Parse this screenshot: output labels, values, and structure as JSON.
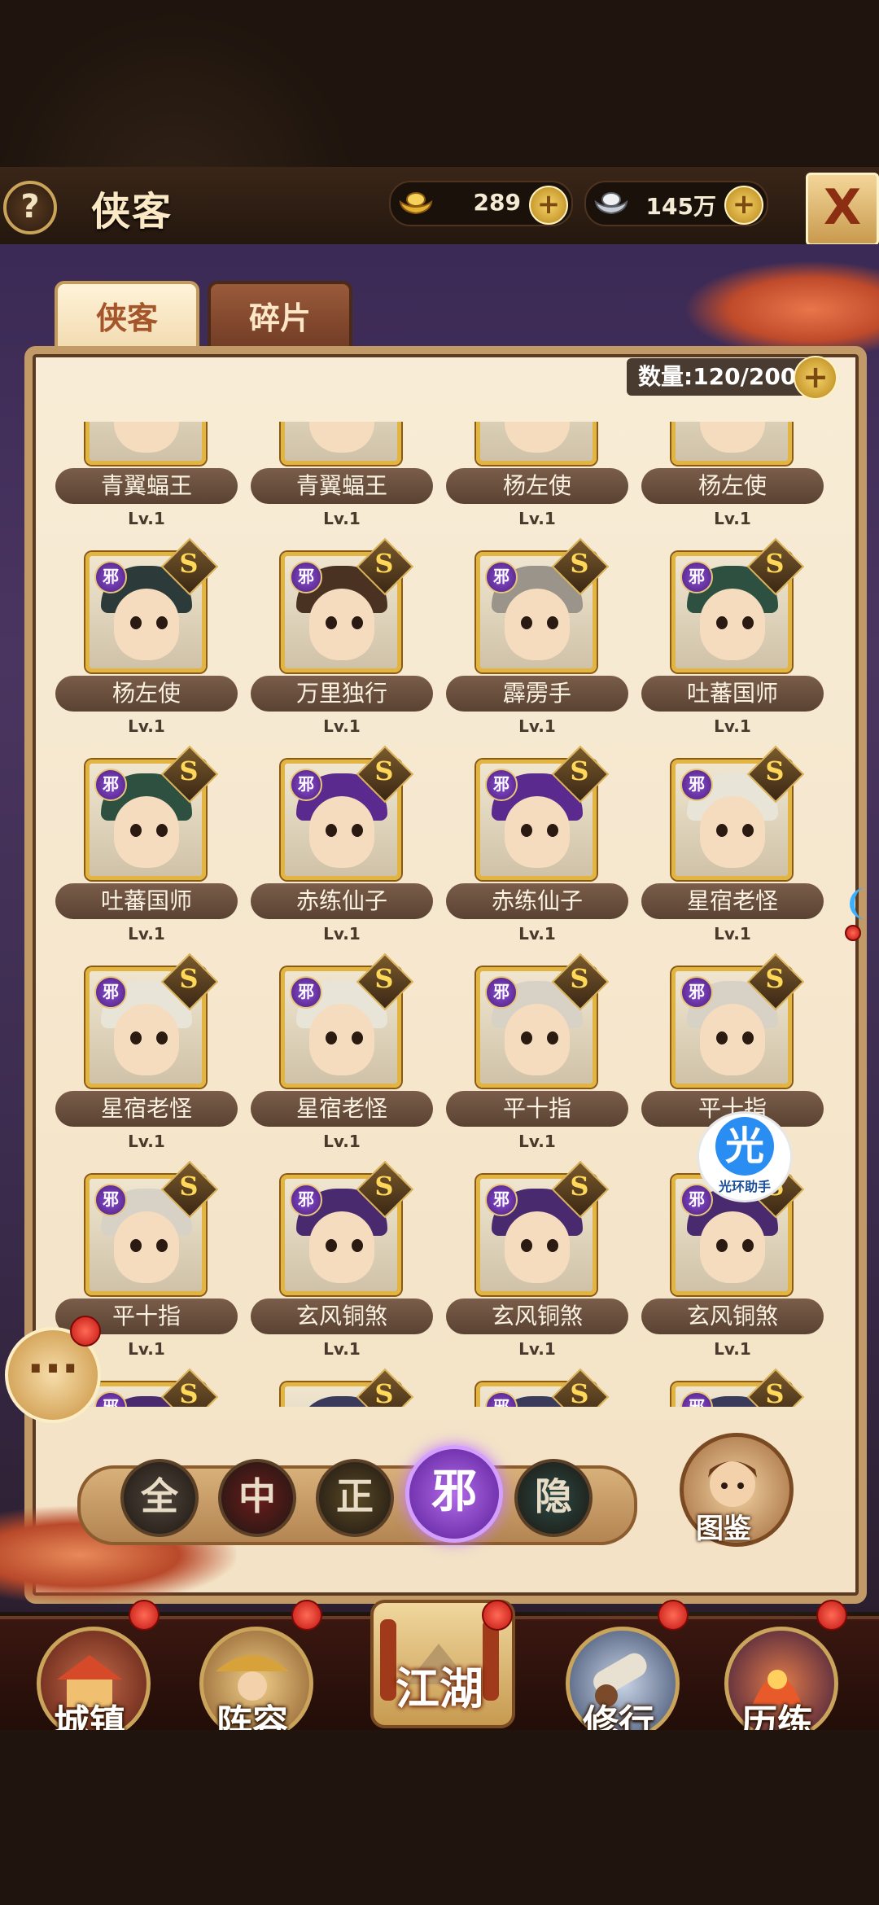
{
  "header": {
    "help_label": "?",
    "title": "侠客",
    "gold": {
      "icon": "gold-ingot-icon",
      "value": "289",
      "plus": "+"
    },
    "silver": {
      "icon": "silver-ingot-icon",
      "value": "145万",
      "plus": "+"
    },
    "close_label": "X"
  },
  "tabs": [
    {
      "label": "侠客",
      "active": true
    },
    {
      "label": "碎片",
      "active": false
    }
  ],
  "count": {
    "label": "数量:120/200",
    "plus": "+"
  },
  "heroes": [
    {
      "name": "青翼蝠王",
      "level": "Lv.1",
      "faction": "",
      "grade": "",
      "hair": "#2b3a4a",
      "cut": true
    },
    {
      "name": "青翼蝠王",
      "level": "Lv.1",
      "faction": "",
      "grade": "",
      "hair": "#2b3a4a",
      "cut": true
    },
    {
      "name": "杨左使",
      "level": "Lv.1",
      "faction": "",
      "grade": "",
      "hair": "#8a8a80",
      "cut": true
    },
    {
      "name": "杨左使",
      "level": "Lv.1",
      "faction": "",
      "grade": "",
      "hair": "#8a8a80",
      "cut": true
    },
    {
      "name": "杨左使",
      "level": "Lv.1",
      "faction": "邪",
      "grade": "S",
      "hair": "#2c3b3a"
    },
    {
      "name": "万里独行",
      "level": "Lv.1",
      "faction": "邪",
      "grade": "S",
      "hair": "#4a3222"
    },
    {
      "name": "霹雳手",
      "level": "Lv.1",
      "faction": "邪",
      "grade": "S",
      "hair": "#9a948a"
    },
    {
      "name": "吐蕃国师",
      "level": "Lv.1",
      "faction": "邪",
      "grade": "S",
      "hair": "#2d5040"
    },
    {
      "name": "吐蕃国师",
      "level": "Lv.1",
      "faction": "邪",
      "grade": "S",
      "hair": "#2d5040"
    },
    {
      "name": "赤练仙子",
      "level": "Lv.1",
      "faction": "邪",
      "grade": "S",
      "hair": "#5b2a8e"
    },
    {
      "name": "赤练仙子",
      "level": "Lv.1",
      "faction": "邪",
      "grade": "S",
      "hair": "#5b2a8e"
    },
    {
      "name": "星宿老怪",
      "level": "Lv.1",
      "faction": "邪",
      "grade": "S",
      "hair": "#e8e4d8"
    },
    {
      "name": "星宿老怪",
      "level": "Lv.1",
      "faction": "邪",
      "grade": "S",
      "hair": "#e8e4d8"
    },
    {
      "name": "星宿老怪",
      "level": "Lv.1",
      "faction": "邪",
      "grade": "S",
      "hair": "#e8e4d8"
    },
    {
      "name": "平十指",
      "level": "Lv.1",
      "faction": "邪",
      "grade": "S",
      "hair": "#d8d2c6"
    },
    {
      "name": "平十指",
      "level": "Lv.1",
      "faction": "邪",
      "grade": "S",
      "hair": "#d8d2c6"
    },
    {
      "name": "平十指",
      "level": "Lv.1",
      "faction": "邪",
      "grade": "S",
      "hair": "#d8d2c6"
    },
    {
      "name": "玄风铜煞",
      "level": "Lv.1",
      "faction": "邪",
      "grade": "S",
      "hair": "#4a2a6e"
    },
    {
      "name": "玄风铜煞",
      "level": "Lv.1",
      "faction": "邪",
      "grade": "S",
      "hair": "#4a2a6e"
    },
    {
      "name": "玄风铜煞",
      "level": "Lv.1",
      "faction": "邪",
      "grade": "S",
      "hair": "#4a2a6e"
    },
    {
      "name": "",
      "level": "",
      "faction": "邪",
      "grade": "S",
      "hair": "#4a2a6e"
    },
    {
      "name": "",
      "level": "",
      "faction": "",
      "grade": "S",
      "hair": "#3a3a5a"
    },
    {
      "name": "",
      "level": "",
      "faction": "邪",
      "grade": "S",
      "hair": "#3a3a5a"
    },
    {
      "name": "",
      "level": "",
      "faction": "邪",
      "grade": "S",
      "hair": "#3a3a5a"
    }
  ],
  "filters": [
    {
      "label": "全",
      "color": "#4f463c",
      "active": false
    },
    {
      "label": "中",
      "color": "#6a1c1c",
      "active": false
    },
    {
      "label": "正",
      "color": "#5b4a26",
      "active": false
    },
    {
      "label": "邪",
      "color": "#7a2fc2",
      "active": true
    },
    {
      "label": "隐",
      "color": "#2a4a44",
      "active": false
    }
  ],
  "atlas": {
    "label": "图鉴"
  },
  "chat": {
    "icon": "chat-bubble-icon",
    "label": "···"
  },
  "helper": {
    "glyph": "光",
    "label": "光环助手"
  },
  "bottom_nav": [
    {
      "label": "城镇",
      "icon": "town-icon",
      "color": "#8a3a2a"
    },
    {
      "label": "阵容",
      "icon": "lineup-icon",
      "color": "#b07a3a"
    },
    {
      "label": "江湖",
      "icon": "scroll-map-icon",
      "color": "#c79a50"
    },
    {
      "label": "修行",
      "icon": "cannon-icon",
      "color": "#5a6a8a"
    },
    {
      "label": "历练",
      "icon": "trial-icon",
      "color": "#6a3a7a"
    }
  ]
}
